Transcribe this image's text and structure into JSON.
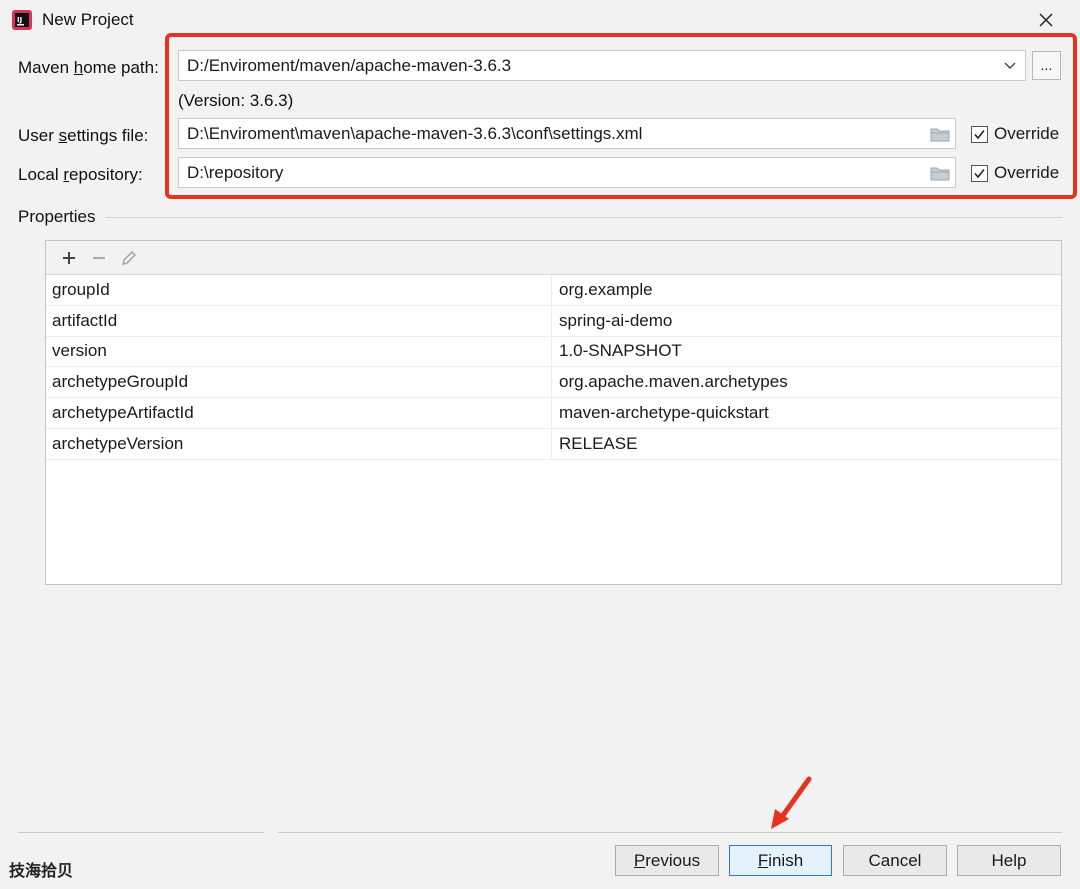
{
  "window": {
    "title": "New Project",
    "close_label": "✕"
  },
  "maven": {
    "home_label_pre": "Maven ",
    "home_label_u": "h",
    "home_label_post": "ome path:",
    "home_value": "D:/Enviroment/maven/apache-maven-3.6.3",
    "browse_label": "...",
    "version_text": "(Version: 3.6.3)",
    "settings_label_pre": "User ",
    "settings_label_u": "s",
    "settings_label_post": "ettings file:",
    "settings_value": "D:\\Enviroment\\maven\\apache-maven-3.6.3\\conf\\settings.xml",
    "settings_override": "Override",
    "repo_label_pre": "Local ",
    "repo_label_u": "r",
    "repo_label_post": "epository:",
    "repo_value": "D:\\repository",
    "repo_override": "Override"
  },
  "properties": {
    "title": "Properties",
    "rows": [
      {
        "key": "groupId",
        "value": "org.example"
      },
      {
        "key": "artifactId",
        "value": "spring-ai-demo"
      },
      {
        "key": "version",
        "value": "1.0-SNAPSHOT"
      },
      {
        "key": "archetypeGroupId",
        "value": "org.apache.maven.archetypes"
      },
      {
        "key": "archetypeArtifactId",
        "value": "maven-archetype-quickstart"
      },
      {
        "key": "archetypeVersion",
        "value": "RELEASE"
      }
    ]
  },
  "footer": {
    "watermark": "技海拾贝",
    "previous_u": "P",
    "previous_rest": "revious",
    "finish_u": "F",
    "finish_rest": "inish",
    "cancel": "Cancel",
    "help": "Help"
  },
  "colors": {
    "highlight": "#e8321e",
    "primary_border": "#2b7ad6",
    "arrow": "#e8321e"
  }
}
